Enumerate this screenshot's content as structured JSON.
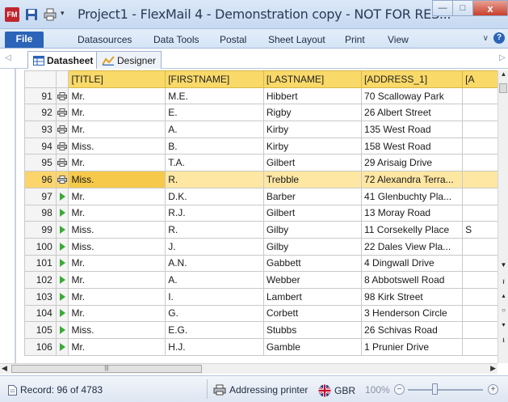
{
  "window": {
    "title": "Project1 - FlexMail 4 - Demonstration copy - NOT FOR RES...",
    "app_icon_text": "FM",
    "minimize_label": "—",
    "maximize_label": "□",
    "close_label": "x"
  },
  "ribbon": {
    "file_label": "File",
    "tabs": [
      "Datasources",
      "Data Tools",
      "Postal",
      "Sheet Layout",
      "Print",
      "View"
    ],
    "help_label": "?"
  },
  "viewtabs": {
    "left_arrow": "◁",
    "right_arrow": "▷",
    "datasheet_label": "Datasheet",
    "designer_label": "Designer"
  },
  "grid": {
    "columns": [
      "[TITLE]",
      "[FIRSTNAME]",
      "[LASTNAME]",
      "[ADDRESS_1]",
      "[A"
    ],
    "selected_row_index": 5,
    "rows": [
      {
        "num": "91",
        "status": "printer",
        "title": "Mr.",
        "firstname": "M.E.",
        "lastname": "Hibbert",
        "address1": "70 Scalloway Park",
        "extra": ""
      },
      {
        "num": "92",
        "status": "printer",
        "title": "Mr.",
        "firstname": "E.",
        "lastname": "Rigby",
        "address1": "26 Albert Street",
        "extra": ""
      },
      {
        "num": "93",
        "status": "printer",
        "title": "Mr.",
        "firstname": "A.",
        "lastname": "Kirby",
        "address1": "135 West Road",
        "extra": ""
      },
      {
        "num": "94",
        "status": "printer",
        "title": "Miss.",
        "firstname": "B.",
        "lastname": "Kirby",
        "address1": "158 West Road",
        "extra": ""
      },
      {
        "num": "95",
        "status": "printer",
        "title": "Mr.",
        "firstname": "T.A.",
        "lastname": "Gilbert",
        "address1": "29 Arisaig Drive",
        "extra": ""
      },
      {
        "num": "96",
        "status": "printer",
        "title": "Miss.",
        "firstname": "R.",
        "lastname": "Trebble",
        "address1": "72 Alexandra Terra...",
        "extra": ""
      },
      {
        "num": "97",
        "status": "play",
        "title": "Mr.",
        "firstname": "D.K.",
        "lastname": "Barber",
        "address1": "41 Glenbuchty Pla...",
        "extra": ""
      },
      {
        "num": "98",
        "status": "play",
        "title": "Mr.",
        "firstname": "R.J.",
        "lastname": "Gilbert",
        "address1": "13 Moray Road",
        "extra": ""
      },
      {
        "num": "99",
        "status": "play",
        "title": "Miss.",
        "firstname": "R.",
        "lastname": "Gilby",
        "address1": "11 Corsekelly Place",
        "extra": "S"
      },
      {
        "num": "100",
        "status": "play",
        "title": "Miss.",
        "firstname": "J.",
        "lastname": "Gilby",
        "address1": "22 Dales View Pla...",
        "extra": ""
      },
      {
        "num": "101",
        "status": "play",
        "title": "Mr.",
        "firstname": "A.N.",
        "lastname": "Gabbett",
        "address1": "4 Dingwall Drive",
        "extra": ""
      },
      {
        "num": "102",
        "status": "play",
        "title": "Mr.",
        "firstname": "A.",
        "lastname": "Webber",
        "address1": "8 Abbotswell Road",
        "extra": ""
      },
      {
        "num": "103",
        "status": "play",
        "title": "Mr.",
        "firstname": "I.",
        "lastname": "Lambert",
        "address1": "98 Kirk Street",
        "extra": ""
      },
      {
        "num": "104",
        "status": "play",
        "title": "Mr.",
        "firstname": "G.",
        "lastname": "Corbett",
        "address1": "3 Henderson Circle",
        "extra": ""
      },
      {
        "num": "105",
        "status": "play",
        "title": "Miss.",
        "firstname": "E.G.",
        "lastname": "Stubbs",
        "address1": "26 Schivas Road",
        "extra": ""
      },
      {
        "num": "106",
        "status": "play",
        "title": "Mr.",
        "firstname": "H.J.",
        "lastname": "Gamble",
        "address1": "1 Prunier Drive",
        "extra": ""
      }
    ]
  },
  "statusbar": {
    "record_text": "Record: 96 of 4783",
    "printer_text": "Addressing printer",
    "country_text": "GBR",
    "zoom_text": "100%",
    "zoom_minus": "−",
    "zoom_plus": "+"
  },
  "colors": {
    "header_yellow": "#f9d968",
    "selected_row": "#fde7a3",
    "file_tab_blue": "#2b64b8",
    "play_green": "#3aaa35"
  }
}
